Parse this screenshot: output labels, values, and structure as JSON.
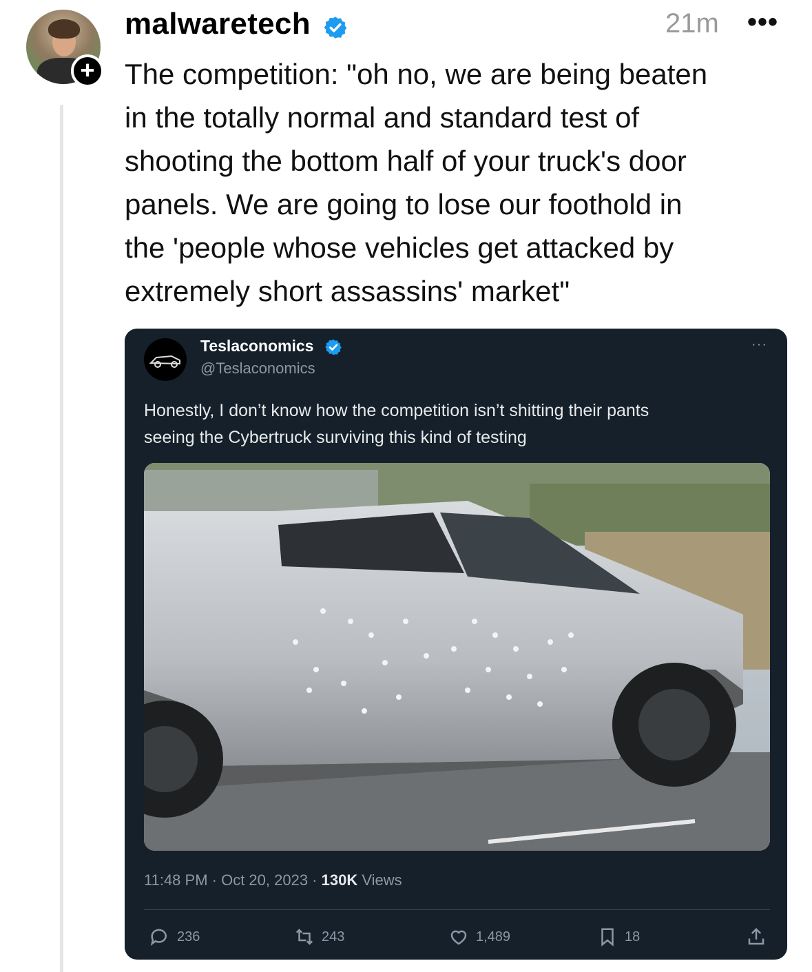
{
  "post": {
    "username": "malwaretech",
    "timestamp": "21m",
    "more_label": "•••",
    "follow_label": "+",
    "text_lines": [
      "The competition: \"oh no, we are being beaten",
      "in the totally normal and standard test of",
      "shooting the bottom half of your truck's door",
      "panels. We are going to lose our foothold in",
      "the 'people whose vehicles get attacked by",
      "extremely short assassins' market\""
    ]
  },
  "embed": {
    "name": "Teslaconomics",
    "handle": "@Teslaconomics",
    "more_label": "···",
    "text_lines": [
      "Honestly, I don’t know how the competition isn’t shitting their pants",
      "seeing the Cybertruck surviving this kind of testing"
    ],
    "meta": {
      "time_date": "11:48 PM · Oct 20, 2023 · ",
      "views_count": "130K",
      "views_label": " Views"
    },
    "actions": {
      "replies": "236",
      "reposts": "243",
      "likes": "1,489",
      "bookmarks": "18"
    }
  },
  "colors": {
    "verified": "#1d9bf0",
    "embed_bg": "#15202b",
    "muted": "#8b98a5"
  },
  "icons": [
    "verified-badge-icon",
    "reply-icon",
    "repost-icon",
    "like-icon",
    "bookmark-icon",
    "share-icon"
  ]
}
